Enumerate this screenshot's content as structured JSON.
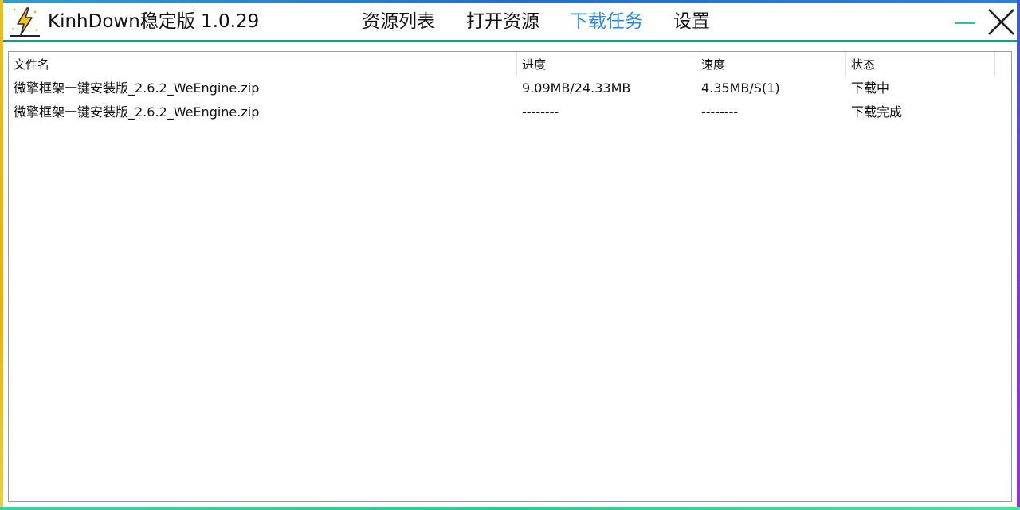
{
  "app": {
    "title": "KinhDown稳定版 1.0.29",
    "accent_color": "#2a8ce0",
    "titlebar_line_color": "#1a9a8a",
    "logo_icon": "lightning-bolt-icon"
  },
  "nav": {
    "items": [
      {
        "label": "资源列表",
        "active": false
      },
      {
        "label": "打开资源",
        "active": false
      },
      {
        "label": "下载任务",
        "active": true
      },
      {
        "label": "设置",
        "active": false
      }
    ]
  },
  "window_controls": {
    "minimize_icon": "minimize-icon",
    "close_icon": "close-icon"
  },
  "table": {
    "columns": [
      "文件名",
      "进度",
      "速度",
      "状态"
    ],
    "rows": [
      {
        "name": "微擎框架一键安装版_2.6.2_WeEngine.zip",
        "progress": "9.09MB/24.33MB",
        "speed": "4.35MB/S(1)",
        "status": "下载中"
      },
      {
        "name": "微擎框架一键安装版_2.6.2_WeEngine.zip",
        "progress": "--------",
        "speed": "--------",
        "status": "下载完成"
      }
    ]
  }
}
